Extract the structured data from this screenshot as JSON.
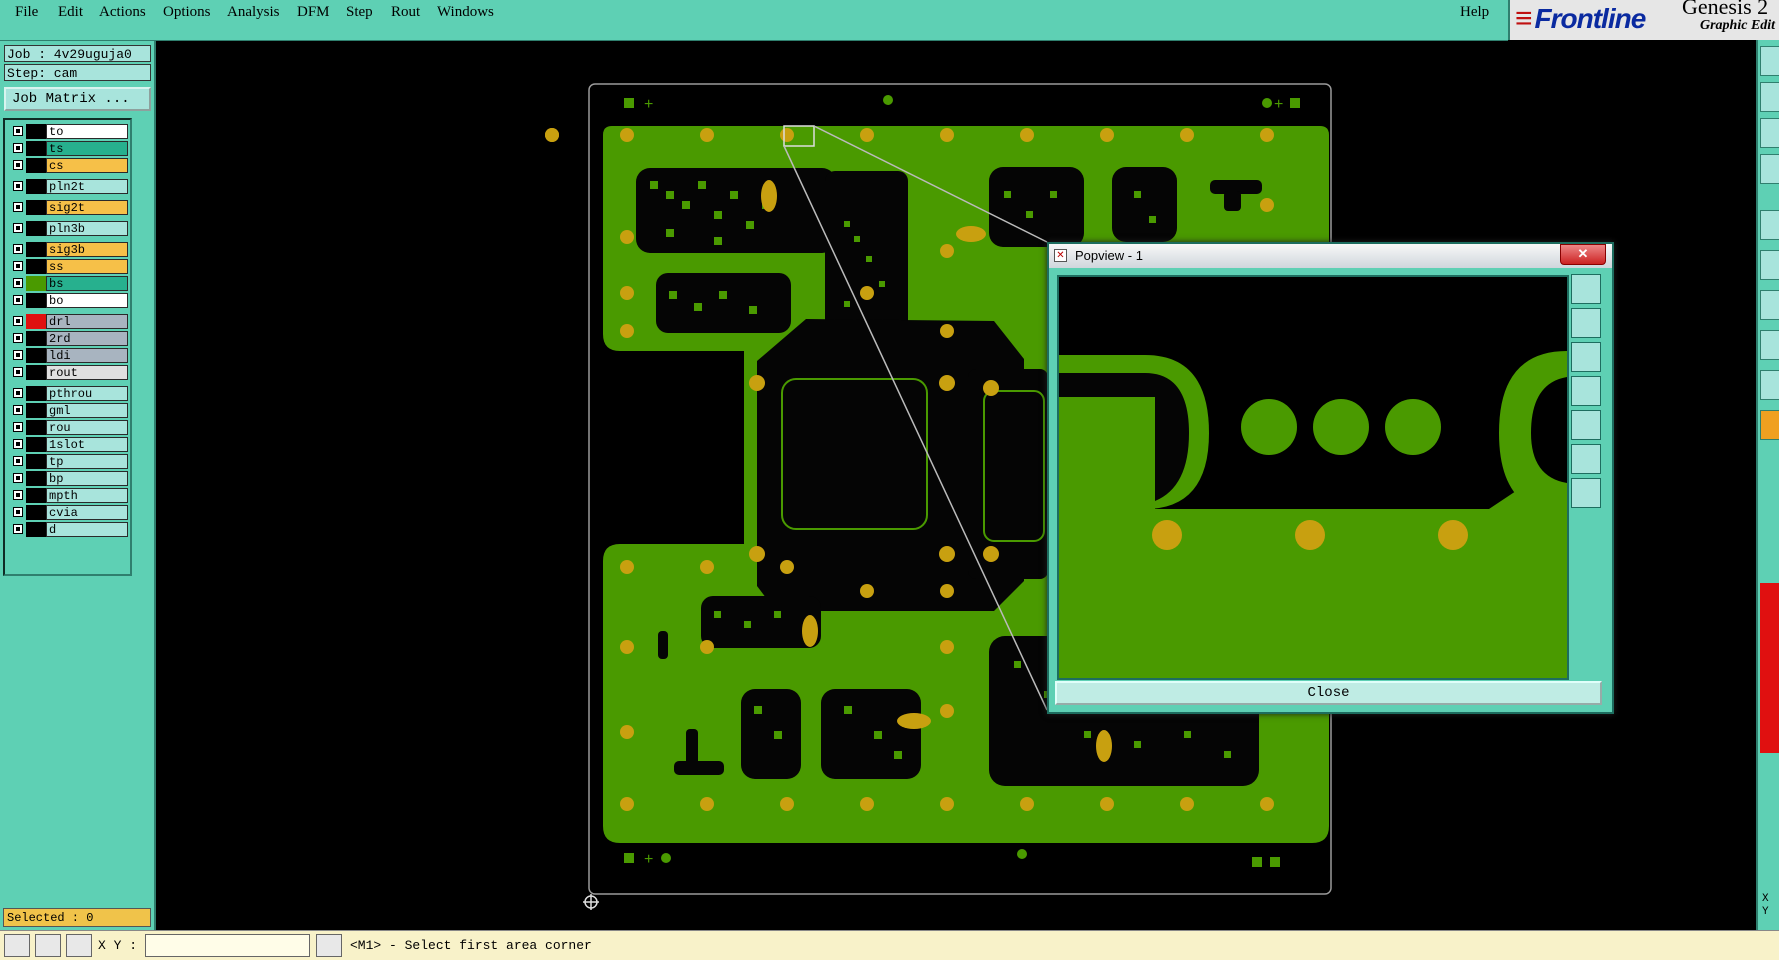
{
  "menu": {
    "items": [
      "File",
      "Edit",
      "Actions",
      "Options",
      "Analysis",
      "DFM",
      "Step",
      "Rout",
      "Windows"
    ],
    "help": "Help"
  },
  "brand": {
    "logo": "Frontline",
    "title": "Genesis 2",
    "subtitle": "Graphic Edit"
  },
  "job": {
    "job_label": "Job : 4v29uguja0",
    "step_label": "Step: cam",
    "matrix_button": "Job Matrix ..."
  },
  "layers": [
    {
      "name": "to",
      "color": "#ffffff"
    },
    {
      "name": "ts",
      "color": "#27b08e"
    },
    {
      "name": "cs",
      "color": "#f6c048"
    },
    {
      "name": "pln2t",
      "color": "#a8e4dc"
    },
    {
      "name": "sig2t",
      "color": "#f6c048"
    },
    {
      "name": "pln3b",
      "color": "#a8e4dc"
    },
    {
      "name": "sig3b",
      "color": "#f6c048"
    },
    {
      "name": "ss",
      "color": "#f6c048"
    },
    {
      "name": "bs",
      "color": "#27b08e"
    },
    {
      "name": "bo",
      "color": "#ffffff"
    },
    {
      "name": "drl",
      "color": "#a8b4c0"
    },
    {
      "name": "2rd",
      "color": "#a8b4c0"
    },
    {
      "name": "ldi",
      "color": "#a8b4c0"
    },
    {
      "name": "rout",
      "color": "#e0e0e0"
    },
    {
      "name": "pthrou",
      "color": "#a8e4dc"
    },
    {
      "name": "gml",
      "color": "#a8e4dc"
    },
    {
      "name": "rou",
      "color": "#a8e4dc"
    },
    {
      "name": "1slot",
      "color": "#a8e4dc"
    },
    {
      "name": "tp",
      "color": "#a8e4dc"
    },
    {
      "name": "bp",
      "color": "#a8e4dc"
    },
    {
      "name": "mpth",
      "color": "#a8e4dc"
    },
    {
      "name": "cvia",
      "color": "#a8e4dc"
    },
    {
      "name": "d",
      "color": "#a8e4dc"
    }
  ],
  "selected": "Selected : 0",
  "status": {
    "xy_label": "X Y :",
    "xy_value": "",
    "message": "<M1> - Select first area corner"
  },
  "popview": {
    "title": "Popview - 1",
    "close": "Close"
  },
  "right_toolbar": {
    "xy": "X\nY"
  },
  "colors": {
    "board": "#4a9a00",
    "pad": "#c8a010",
    "background": "#000000",
    "panel": "#5ed0b4"
  }
}
